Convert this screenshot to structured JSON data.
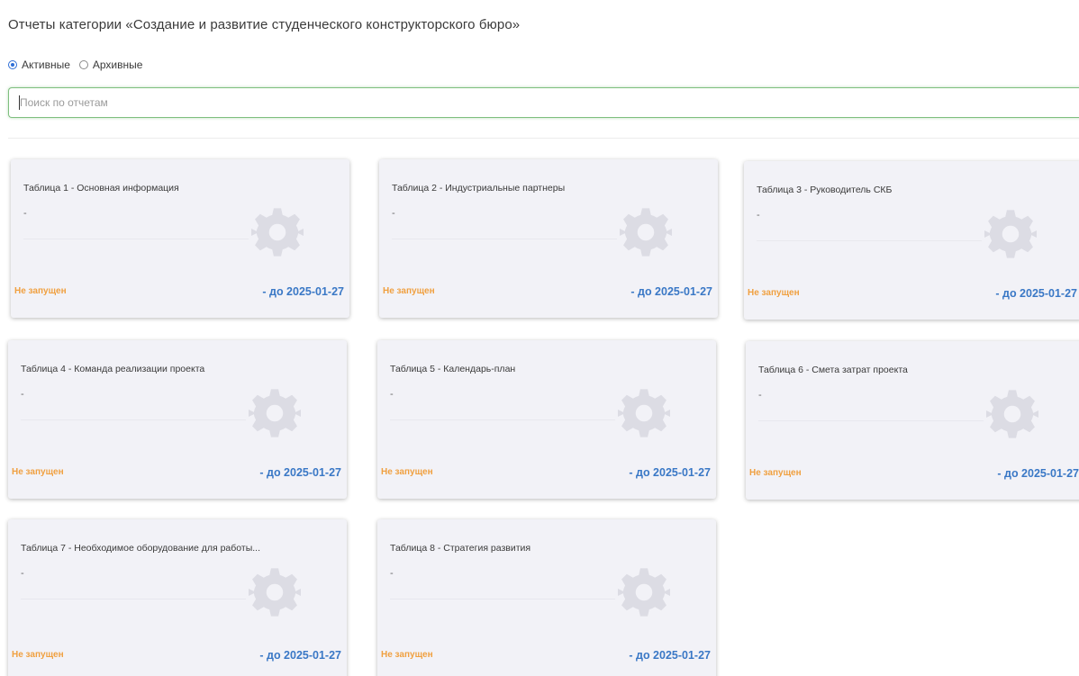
{
  "page_title": "Отчеты категории «Создание и развитие студенческого конструкторского бюро»",
  "filter": {
    "active_label": "Активные",
    "archived_label": "Архивные",
    "selected": "Активные"
  },
  "search": {
    "placeholder": "Поиск по отчетам",
    "value": ""
  },
  "colors": {
    "status_not_started": "#f0a040",
    "deadline": "#3a78c6",
    "search_border": "#7fbf7f",
    "radio_selected": "#2f6fd6"
  },
  "cards": [
    {
      "title": "Таблица 1 - Основная информация",
      "description": "-",
      "status": "Не запущен",
      "deadline": "- до 2025-01-27",
      "icon": "gear-icon"
    },
    {
      "title": "Таблица 2 - Индустриальные партнеры",
      "description": "-",
      "status": "Не запущен",
      "deadline": "- до 2025-01-27",
      "icon": "gear-icon"
    },
    {
      "title": "Таблица 3 - Руководитель СКБ",
      "description": "-",
      "status": "Не запущен",
      "deadline": "- до 2025-01-27",
      "icon": "gear-icon"
    },
    {
      "title": "Таблица 4 - Команда реализации проекта",
      "description": "-",
      "status": "Не запущен",
      "deadline": "- до 2025-01-27",
      "icon": "gear-icon"
    },
    {
      "title": "Таблица 5 - Календарь-план",
      "description": "-",
      "status": "Не запущен",
      "deadline": "- до 2025-01-27",
      "icon": "gear-icon"
    },
    {
      "title": "Таблица 6 - Смета затрат проекта",
      "description": "-",
      "status": "Не запущен",
      "deadline": "- до 2025-01-27",
      "icon": "gear-icon"
    },
    {
      "title": "Таблица 7 - Необходимое оборудование для работы...",
      "description": "-",
      "status": "Не запущен",
      "deadline": "- до 2025-01-27",
      "icon": "gear-icon"
    },
    {
      "title": "Таблица 8 - Стратегия развития",
      "description": "-",
      "status": "Не запущен",
      "deadline": "- до 2025-01-27",
      "icon": "gear-icon"
    }
  ]
}
